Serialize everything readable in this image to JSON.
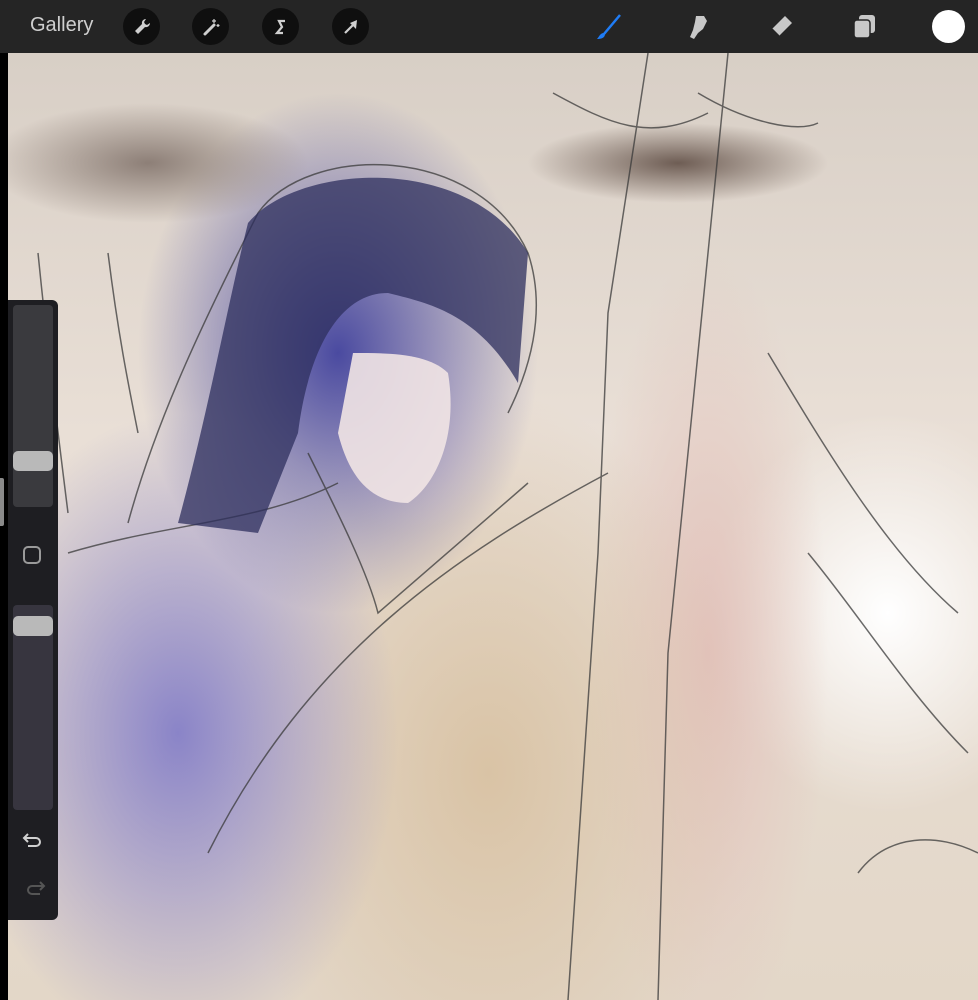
{
  "toolbar": {
    "gallery_label": "Gallery",
    "left_tools": [
      "wrench-icon",
      "magic-wand-icon",
      "selection-icon",
      "transform-arrow-icon"
    ],
    "right_tools": [
      "brush-icon",
      "smudge-icon",
      "eraser-icon",
      "layers-icon"
    ],
    "active_tool": "brush",
    "active_color": "#ffffff",
    "accent": "#1f7cf5"
  },
  "sidebar": {
    "brush_size": 0.2,
    "opacity": 0.94,
    "undo": "undo-icon",
    "redo": "redo-icon"
  }
}
